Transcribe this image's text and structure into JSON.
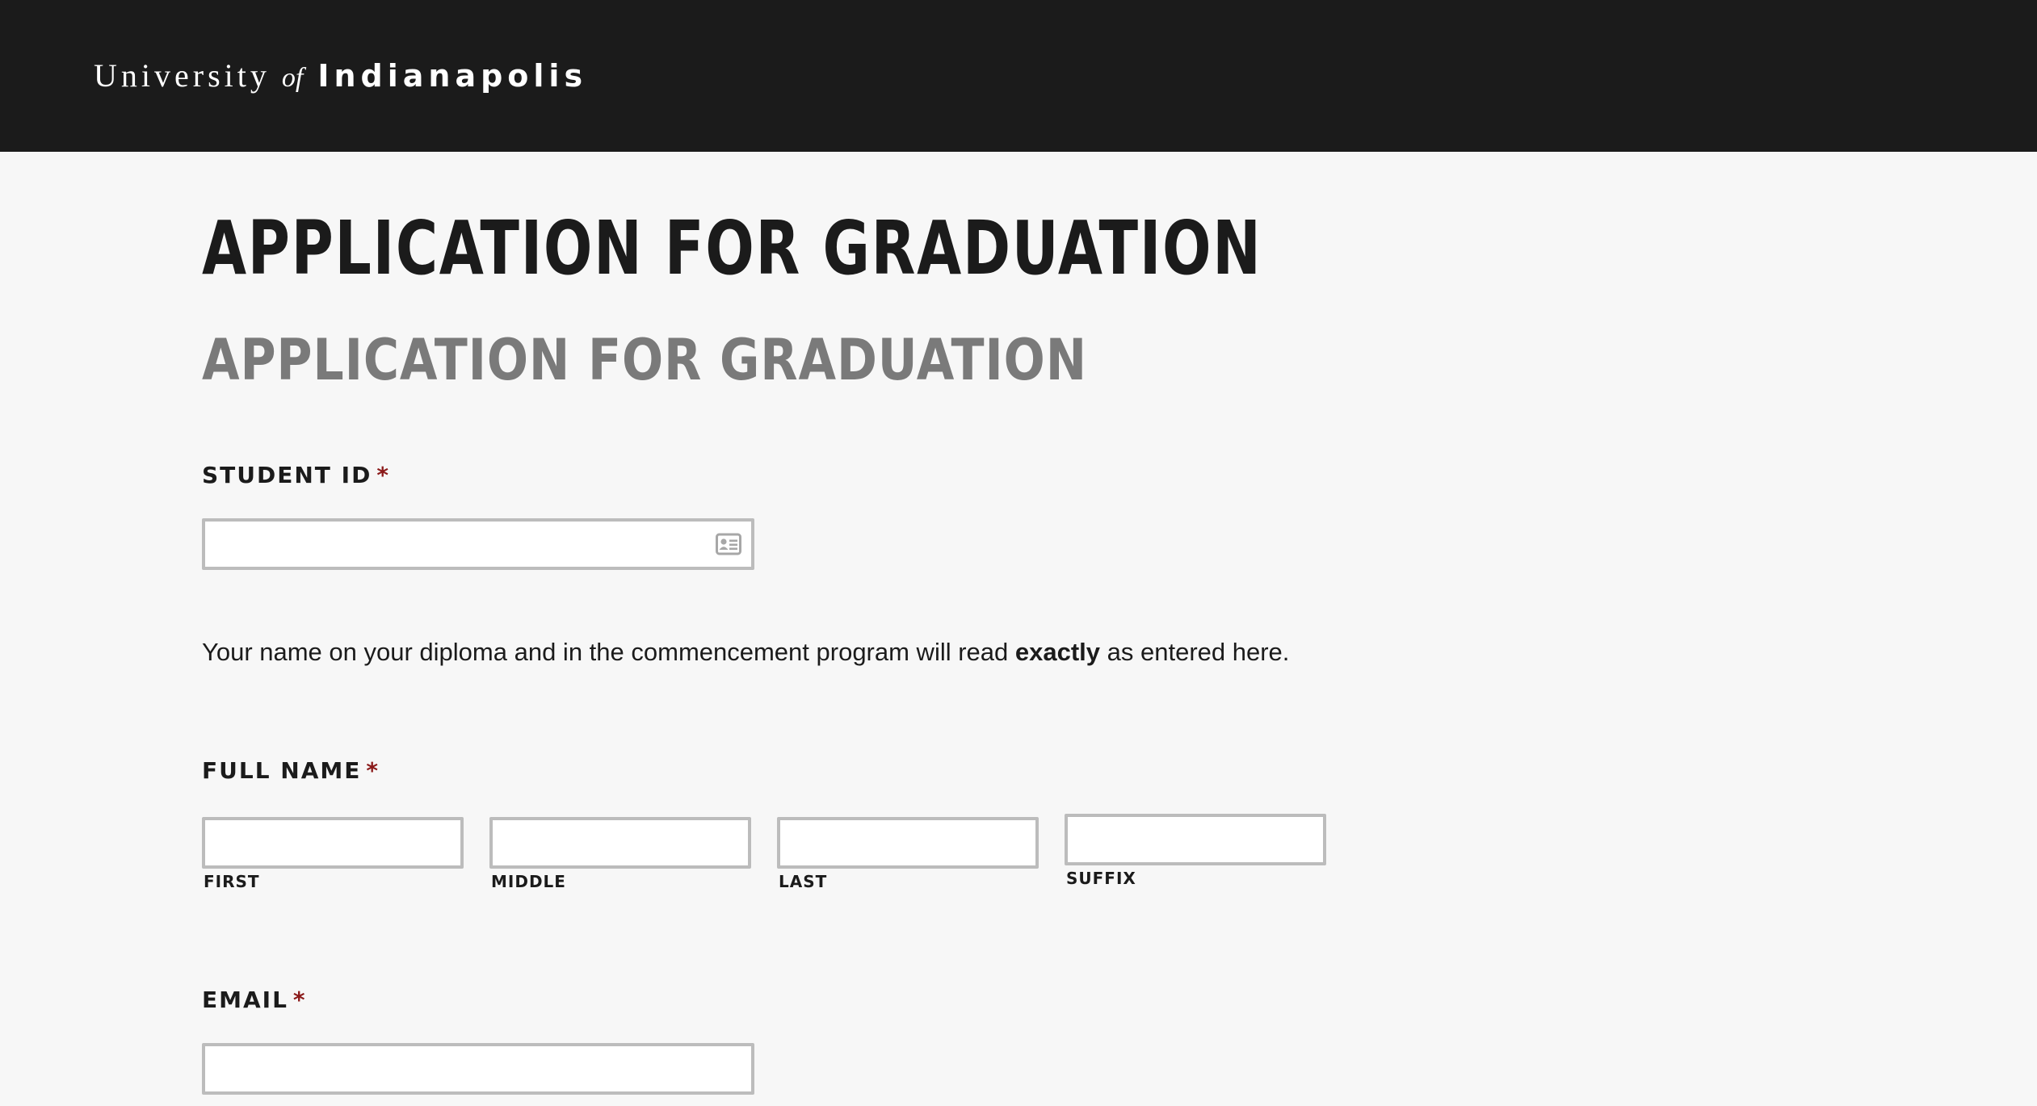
{
  "header": {
    "logo_university": "University",
    "logo_of": "of",
    "logo_indianapolis": "Indianapolis"
  },
  "page": {
    "title": "APPLICATION FOR GRADUATION",
    "subtitle": "APPLICATION FOR GRADUATION"
  },
  "form": {
    "required_marker": "*",
    "student_id": {
      "label": "STUDENT ID",
      "value": "",
      "icon": "contact-card-icon"
    },
    "help_text": {
      "before": "Your name on your diploma and in the commencement program will read ",
      "emphasis": "exactly",
      "after": " as entered here."
    },
    "full_name": {
      "label": "FULL NAME",
      "first_label": "FIRST",
      "middle_label": "MIDDLE",
      "last_label": "LAST",
      "suffix_label": "SUFFIX",
      "first_value": "",
      "middle_value": "",
      "last_value": "",
      "suffix_value": ""
    },
    "email": {
      "label": "EMAIL",
      "value": ""
    }
  },
  "colors": {
    "header_bg": "#1b1b1b",
    "page_bg": "#f7f7f7",
    "required": "#8b1a1a",
    "subtitle": "#7a7a7a",
    "input_border": "#bcbcbc"
  }
}
